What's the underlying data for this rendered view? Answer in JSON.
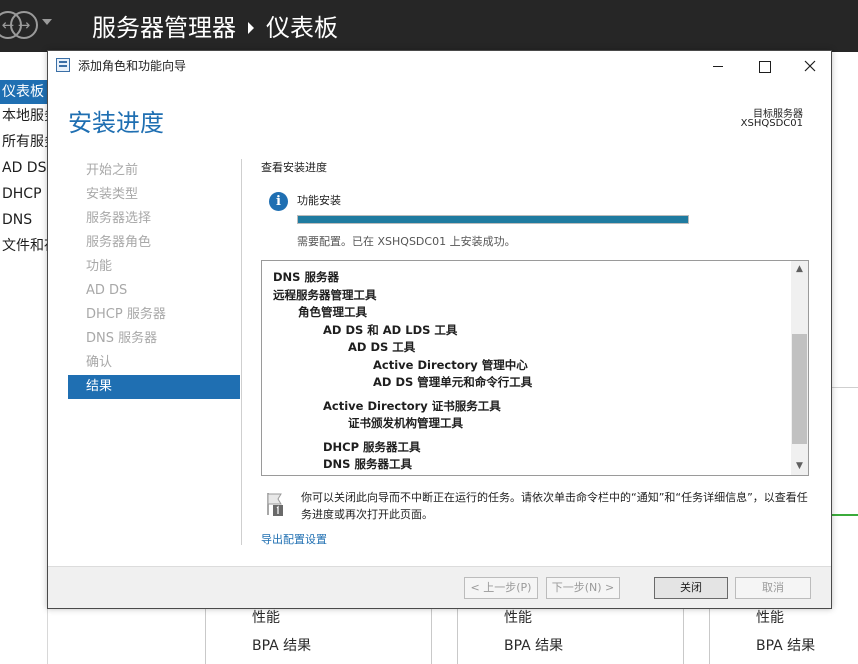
{
  "server_manager": {
    "title": "服务器管理器",
    "page": "仪表板",
    "sidebar": [
      {
        "label": "仪表板",
        "active": true
      },
      {
        "label": "本地服务器",
        "active": false
      },
      {
        "label": "所有服务器",
        "active": false
      },
      {
        "label": "AD DS",
        "active": false
      },
      {
        "label": "DHCP",
        "active": false
      },
      {
        "label": "DNS",
        "active": false
      },
      {
        "label": "文件和存储服务",
        "active": false
      }
    ],
    "tiles": [
      {
        "performance": "性能",
        "bpa": "BPA 结果"
      },
      {
        "performance": "性能",
        "bpa": "BPA 结果"
      },
      {
        "performance": "性能",
        "bpa": "BPA 结果"
      }
    ]
  },
  "wizard": {
    "window_title": "添加角色和功能向导",
    "heading": "安装进度",
    "target_label": "目标服务器",
    "target_name": "XSHQSDC01",
    "nav": [
      {
        "label": "开始之前",
        "active": false
      },
      {
        "label": "安装类型",
        "active": false
      },
      {
        "label": "服务器选择",
        "active": false
      },
      {
        "label": "服务器角色",
        "active": false
      },
      {
        "label": "功能",
        "active": false
      },
      {
        "label": "AD DS",
        "active": false
      },
      {
        "label": "DHCP 服务器",
        "active": false
      },
      {
        "label": "DNS 服务器",
        "active": false
      },
      {
        "label": "确认",
        "active": false
      },
      {
        "label": "结果",
        "active": true
      }
    ],
    "content_title": "查看安装进度",
    "feature_label": "功能安装",
    "progress": 1.0,
    "status": "需要配置。已在 XSHQSDC01 上安装成功。",
    "results": [
      {
        "text": "DNS 服务器",
        "level": 0,
        "gap": false
      },
      {
        "text": "远程服务器管理工具",
        "level": 0,
        "gap": false
      },
      {
        "text": "角色管理工具",
        "level": 1,
        "gap": false
      },
      {
        "text": "AD DS 和 AD LDS 工具",
        "level": 2,
        "gap": false
      },
      {
        "text": "AD DS 工具",
        "level": 3,
        "gap": false
      },
      {
        "text": "Active Directory 管理中心",
        "level": 4,
        "gap": false
      },
      {
        "text": "AD DS 管理单元和命令行工具",
        "level": 4,
        "gap": false
      },
      {
        "text": "Active Directory 证书服务工具",
        "level": 2,
        "gap": true
      },
      {
        "text": "证书颁发机构管理工具",
        "level": 3,
        "gap": false
      },
      {
        "text": "DHCP 服务器工具",
        "level": 2,
        "gap": true
      },
      {
        "text": "DNS 服务器工具",
        "level": 2,
        "gap": false
      }
    ],
    "note": "你可以关闭此向导而不中断正在运行的任务。请依次单击命令栏中的“通知”和“任务详细信息”，以查看任务进度或再次打开此页面。",
    "export_link": "导出配置设置",
    "buttons": {
      "prev": "< 上一步(P)",
      "next": "下一步(N) >",
      "close": "关闭",
      "cancel": "取消"
    },
    "colors": {
      "accent": "#1f6fb2",
      "progress": "#1f7ba0"
    }
  }
}
